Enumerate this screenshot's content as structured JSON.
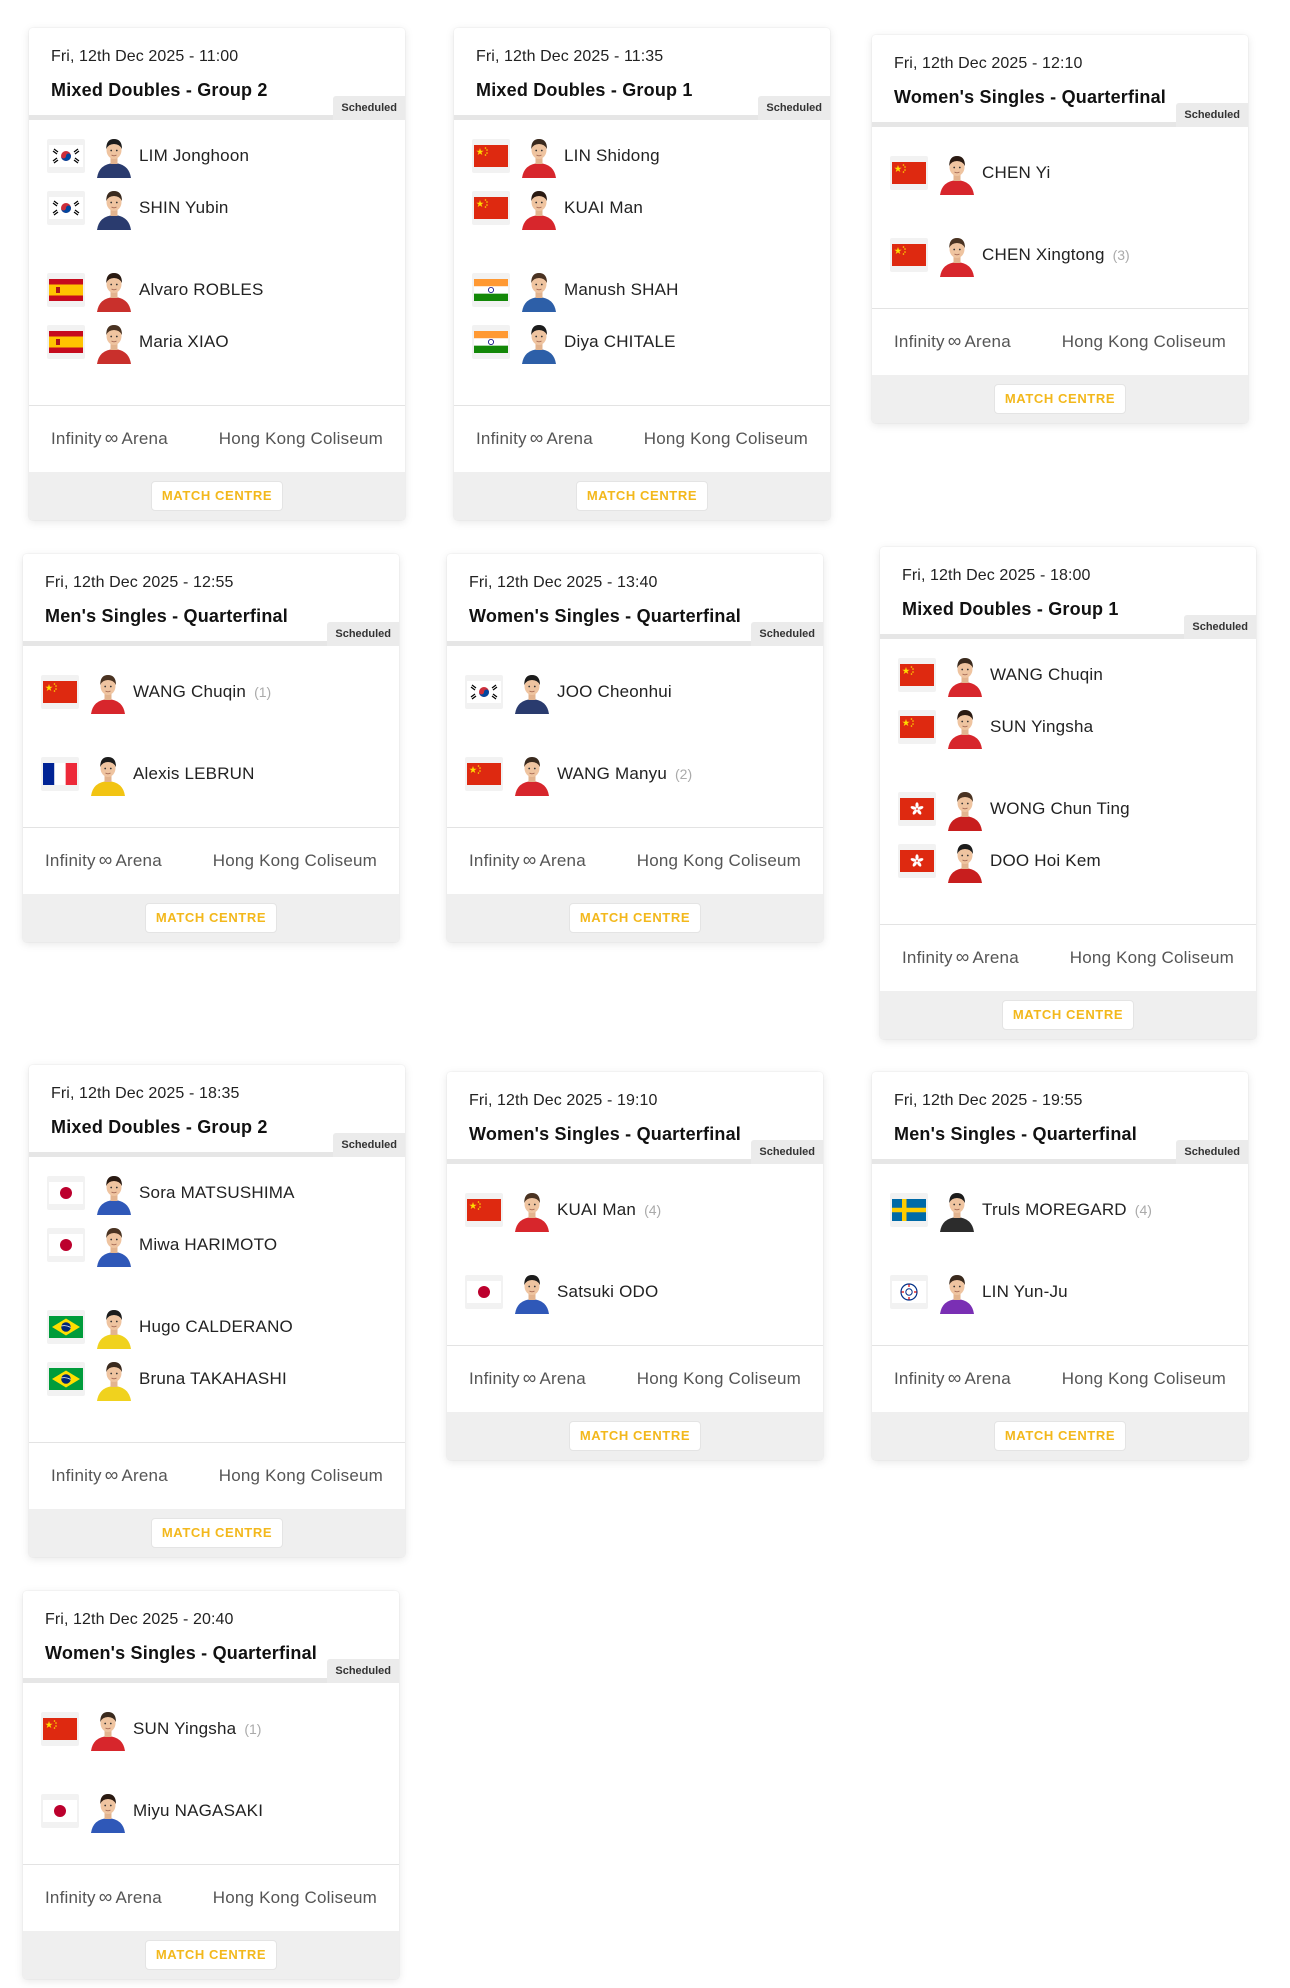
{
  "status_label": "Scheduled",
  "match_centre_label": "MATCH CENTRE",
  "venue_prefix": "Infinity",
  "venue_prefix_symbol": "∞",
  "venue_prefix_suffix": "Arena",
  "colors": {
    "accent": "#f3b81c",
    "badge_bg": "#ebebeb",
    "footer_bg": "#efefef"
  },
  "matches": [
    {
      "datetime": "Fri, 12th Dec 2025 - 11:00",
      "event": "Mixed Doubles - Group 2",
      "venue": "Hong Kong Coliseum",
      "players": [
        {
          "name": "LIM Jonghoon",
          "flag": "kor",
          "seed": ""
        },
        {
          "name": "SHIN Yubin",
          "flag": "kor",
          "seed": ""
        },
        {
          "name": "Alvaro ROBLES",
          "flag": "esp",
          "seed": ""
        },
        {
          "name": "Maria XIAO",
          "flag": "esp",
          "seed": ""
        }
      ]
    },
    {
      "datetime": "Fri, 12th Dec 2025 - 11:35",
      "event": "Mixed Doubles - Group 1",
      "venue": "Hong Kong Coliseum",
      "players": [
        {
          "name": "LIN Shidong",
          "flag": "chn",
          "seed": ""
        },
        {
          "name": "KUAI Man",
          "flag": "chn",
          "seed": ""
        },
        {
          "name": "Manush SHAH",
          "flag": "ind",
          "seed": ""
        },
        {
          "name": "Diya CHITALE",
          "flag": "ind",
          "seed": ""
        }
      ]
    },
    {
      "datetime": "Fri, 12th Dec 2025 - 12:10",
      "event": "Women's Singles - Quarterfinal",
      "venue": "Hong Kong Coliseum",
      "players": [
        {
          "name": "CHEN Yi",
          "flag": "chn",
          "seed": ""
        },
        {
          "name": "CHEN Xingtong",
          "flag": "chn",
          "seed": "(3)"
        }
      ]
    },
    {
      "datetime": "Fri, 12th Dec 2025 - 12:55",
      "event": "Men's Singles - Quarterfinal",
      "venue": "Hong Kong Coliseum",
      "players": [
        {
          "name": "WANG Chuqin",
          "flag": "chn",
          "seed": "(1)"
        },
        {
          "name": "Alexis LEBRUN",
          "flag": "fra",
          "seed": ""
        }
      ]
    },
    {
      "datetime": "Fri, 12th Dec 2025 - 13:40",
      "event": "Women's Singles - Quarterfinal",
      "venue": "Hong Kong Coliseum",
      "players": [
        {
          "name": "JOO Cheonhui",
          "flag": "kor",
          "seed": ""
        },
        {
          "name": "WANG Manyu",
          "flag": "chn",
          "seed": "(2)"
        }
      ]
    },
    {
      "datetime": "Fri, 12th Dec 2025 - 18:00",
      "event": "Mixed Doubles - Group 1",
      "venue": "Hong Kong Coliseum",
      "players": [
        {
          "name": "WANG Chuqin",
          "flag": "chn",
          "seed": ""
        },
        {
          "name": "SUN Yingsha",
          "flag": "chn",
          "seed": ""
        },
        {
          "name": "WONG Chun Ting",
          "flag": "hkg",
          "seed": ""
        },
        {
          "name": "DOO Hoi Kem",
          "flag": "hkg",
          "seed": ""
        }
      ]
    },
    {
      "datetime": "Fri, 12th Dec 2025 - 18:35",
      "event": "Mixed Doubles - Group 2",
      "venue": "Hong Kong Coliseum",
      "players": [
        {
          "name": "Sora MATSUSHIMA",
          "flag": "jpn",
          "seed": ""
        },
        {
          "name": "Miwa HARIMOTO",
          "flag": "jpn",
          "seed": ""
        },
        {
          "name": "Hugo CALDERANO",
          "flag": "bra",
          "seed": ""
        },
        {
          "name": "Bruna TAKAHASHI",
          "flag": "bra",
          "seed": ""
        }
      ]
    },
    {
      "datetime": "Fri, 12th Dec 2025 - 19:10",
      "event": "Women's Singles - Quarterfinal",
      "venue": "Hong Kong Coliseum",
      "players": [
        {
          "name": "KUAI Man",
          "flag": "chn",
          "seed": "(4)"
        },
        {
          "name": "Satsuki ODO",
          "flag": "jpn",
          "seed": ""
        }
      ]
    },
    {
      "datetime": "Fri, 12th Dec 2025 - 19:55",
      "event": "Men's Singles - Quarterfinal",
      "venue": "Hong Kong Coliseum",
      "players": [
        {
          "name": "Truls MOREGARD",
          "flag": "swe",
          "seed": "(4)"
        },
        {
          "name": "LIN Yun-Ju",
          "flag": "tpe",
          "seed": ""
        }
      ]
    },
    {
      "datetime": "Fri, 12th Dec 2025 - 20:40",
      "event": "Women's Singles - Quarterfinal",
      "venue": "Hong Kong Coliseum",
      "players": [
        {
          "name": "SUN Yingsha",
          "flag": "chn",
          "seed": "(1)"
        },
        {
          "name": "Miyu NAGASAKI",
          "flag": "jpn",
          "seed": ""
        }
      ]
    }
  ]
}
